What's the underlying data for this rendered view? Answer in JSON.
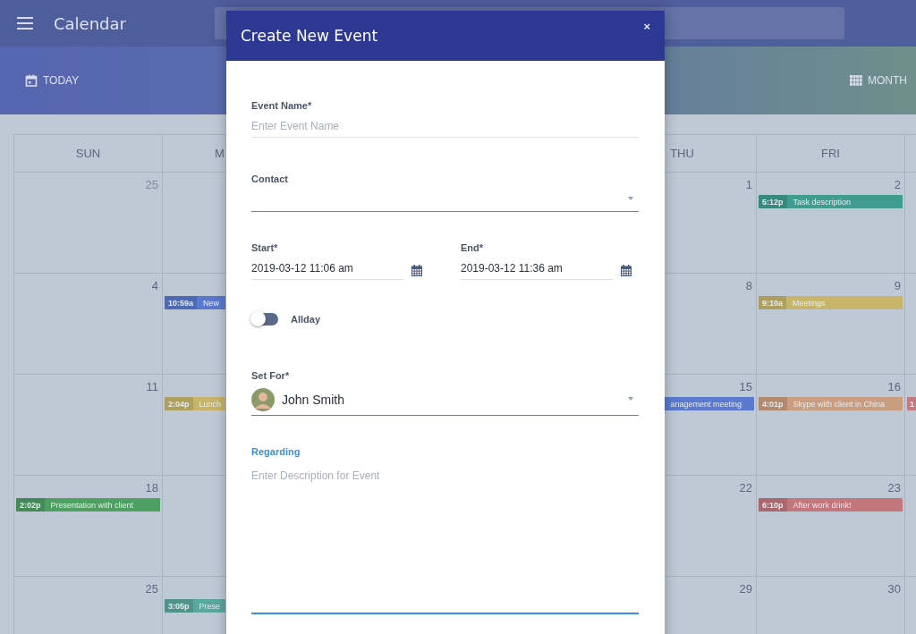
{
  "app_bar": {
    "title": "Calendar"
  },
  "toolbar": {
    "today": "TODAY",
    "view": "MONTH"
  },
  "calendar": {
    "weekdays": {
      "sun": "SUN",
      "mon": "M",
      "thu": "THU",
      "fri": "FRI"
    },
    "weeks": [
      {
        "sun": {
          "date": "25",
          "muted": true
        },
        "thu": {
          "date": "1",
          "muted": false
        },
        "fri": {
          "date": "2",
          "muted": false,
          "events": [
            {
              "time": "5:12p",
              "title": "Task description",
              "color": "#3f9c8f"
            }
          ]
        }
      },
      {
        "sun": {
          "date": "4",
          "muted": false
        },
        "mon": {
          "events": [
            {
              "time": "10:59a",
              "title": "New",
              "color": "#5a79cf"
            }
          ]
        },
        "thu": {
          "date": "8",
          "muted": false
        },
        "fri": {
          "date": "9",
          "muted": false,
          "events": [
            {
              "time": "9:10a",
              "title": "Meetings",
              "color": "#c8b56c"
            }
          ]
        }
      },
      {
        "sun": {
          "date": "11",
          "muted": false
        },
        "mon": {
          "events": [
            {
              "time": "2:04p",
              "title": "Lunch",
              "color": "#c8b56c"
            }
          ]
        },
        "thu": {
          "date": "15",
          "muted": false,
          "events": [
            {
              "kind": "continuation",
              "title": "anagement meeting",
              "color": "#5a79cf"
            }
          ]
        },
        "fri": {
          "date": "16",
          "muted": false,
          "events": [
            {
              "time": "4:01p",
              "title": "Skype with client in China",
              "color": "#c99d7f"
            }
          ]
        },
        "sat": {
          "events": [
            {
              "time": "1",
              "color": "#c47a80"
            }
          ]
        }
      },
      {
        "sun": {
          "date": "18",
          "muted": false,
          "events": [
            {
              "time": "2:02p",
              "title": "Presentation with client",
              "color": "#4f9e62"
            }
          ]
        },
        "thu": {
          "date": "22",
          "muted": false
        },
        "fri": {
          "date": "23",
          "muted": false,
          "events": [
            {
              "time": "6:10p",
              "title": "After work drink!",
              "color": "#c4767d"
            }
          ]
        }
      },
      {
        "sun": {
          "date": "25",
          "muted": false
        },
        "mon": {
          "events": [
            {
              "time": "3:05p",
              "title": "Prese",
              "color": "#5aa89c"
            }
          ]
        },
        "thu": {
          "date": "29",
          "muted": false
        },
        "fri": {
          "date": "30",
          "muted": false
        }
      }
    ]
  },
  "dialog": {
    "title": "Create New Event",
    "close": "×",
    "event_name": {
      "label": "Event Name*",
      "placeholder": "Enter Event Name"
    },
    "contact": {
      "label": "Contact"
    },
    "start": {
      "label": "Start*",
      "value": "2019-03-12 11:06 am"
    },
    "end": {
      "label": "End*",
      "value": "2019-03-12 11:36 am"
    },
    "allday": {
      "label": "Allday",
      "on": false
    },
    "set_for": {
      "label": "Set For*",
      "value": "John Smith"
    },
    "regarding": {
      "label": "Regarding",
      "placeholder": "Enter Description for Event",
      "focused": true
    }
  }
}
